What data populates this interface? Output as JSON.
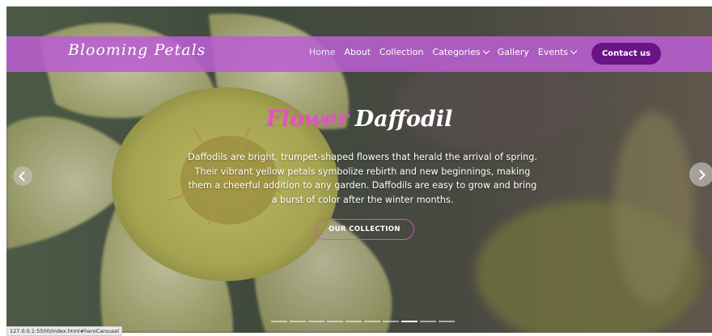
{
  "brand": {
    "name": "Blooming Petals"
  },
  "nav": {
    "items": [
      {
        "label": "Home",
        "active": true,
        "dropdown": false
      },
      {
        "label": "About",
        "active": false,
        "dropdown": false
      },
      {
        "label": "Collection",
        "active": false,
        "dropdown": false
      },
      {
        "label": "Categories",
        "active": false,
        "dropdown": true
      },
      {
        "label": "Gallery",
        "active": false,
        "dropdown": false
      },
      {
        "label": "Events",
        "active": false,
        "dropdown": true
      }
    ],
    "contact_label": "Contact us"
  },
  "hero": {
    "title_word1": "Flower",
    "title_word2": "Daffodil",
    "description": "Daffodils are bright, trumpet-shaped flowers that herald the arrival of spring. Their vibrant yellow petals symbolize rebirth and new beginnings, making them a cheerful addition to any garden. Daffodils are easy to grow and bring a burst of color after the winter months.",
    "button_label": "OUR COLLECTION"
  },
  "carousel": {
    "slide_count": 10,
    "active_index": 7,
    "prev_icon": "chevron-left-icon",
    "next_icon": "chevron-right-icon"
  },
  "status_bar": {
    "url": "127.0.0.1:5500/index.html#heroCarousel"
  },
  "colors": {
    "nav_bg": "#ba5fd0",
    "contact_bg": "#6a1488",
    "title_accent": "#e64fc9",
    "button_border": "#d257c2",
    "flower_yellow": "#d8d66a"
  }
}
